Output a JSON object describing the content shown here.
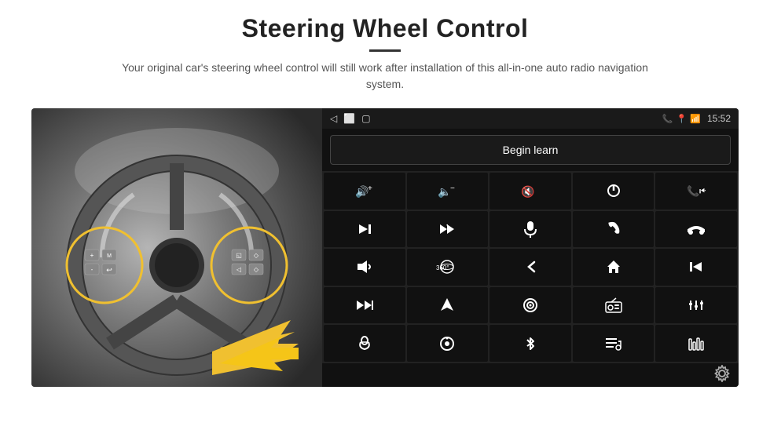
{
  "header": {
    "title": "Steering Wheel Control",
    "divider": true,
    "subtitle": "Your original car's steering wheel control will still work after installation of this all-in-one auto radio navigation system."
  },
  "statusbar": {
    "time": "15:52",
    "nav_back": "◁",
    "nav_home": "⬜",
    "nav_square": "▢"
  },
  "begin_learn_btn": "Begin learn",
  "controls": [
    {
      "icon": "🔊+",
      "label": "vol-up"
    },
    {
      "icon": "🔊-",
      "label": "vol-down"
    },
    {
      "icon": "🔇",
      "label": "mute"
    },
    {
      "icon": "⏻",
      "label": "power"
    },
    {
      "icon": "📞⏮",
      "label": "call-prev"
    },
    {
      "icon": "⏭",
      "label": "next"
    },
    {
      "icon": "✂⏭",
      "label": "skip"
    },
    {
      "icon": "🎤",
      "label": "mic"
    },
    {
      "icon": "📞",
      "label": "call"
    },
    {
      "icon": "↩",
      "label": "hang-up"
    },
    {
      "icon": "📢",
      "label": "speaker"
    },
    {
      "icon": "360°",
      "label": "360"
    },
    {
      "icon": "↩",
      "label": "back"
    },
    {
      "icon": "🏠",
      "label": "home"
    },
    {
      "icon": "⏮⏮",
      "label": "prev-track"
    },
    {
      "icon": "⏭⏭",
      "label": "fast-forward"
    },
    {
      "icon": "▶",
      "label": "nav"
    },
    {
      "icon": "⏺",
      "label": "source"
    },
    {
      "icon": "📻",
      "label": "radio"
    },
    {
      "icon": "🎛",
      "label": "settings"
    },
    {
      "icon": "🎤",
      "label": "mic2"
    },
    {
      "icon": "🔘",
      "label": "knob"
    },
    {
      "icon": "✱",
      "label": "bluetooth"
    },
    {
      "icon": "🎵",
      "label": "music"
    },
    {
      "icon": "📊",
      "label": "eq"
    }
  ],
  "settings_icon": "⚙"
}
